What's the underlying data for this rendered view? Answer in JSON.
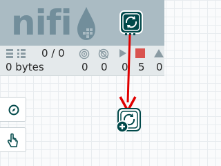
{
  "header": {
    "logo_text": "nifi",
    "colors": {
      "header_bg": "#aabbc3",
      "logo": "#728e9b",
      "accent_red": "#d9534f"
    }
  },
  "toolbar": {
    "processor_tool_icon": "processor-icon"
  },
  "status": {
    "queued_count": "0 / 0",
    "queued_size": "0 bytes",
    "transmitting": "0",
    "not_transmitting": "0",
    "running": "0",
    "stopped": "5",
    "invalid": "0"
  },
  "sidebar": {
    "navigate_icon": "compass-icon",
    "operate_icon": "pointer-hand-icon"
  },
  "canvas": {
    "drag_ghost_icon": "processor-add-icon",
    "arrow_color": "#e00000"
  }
}
